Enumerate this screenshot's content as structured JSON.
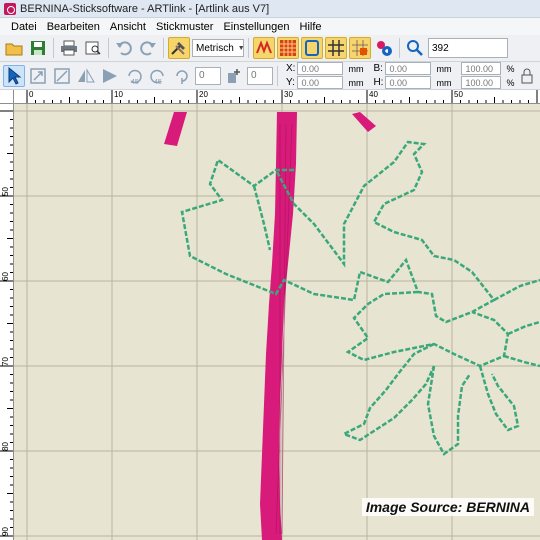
{
  "window": {
    "title": "BERNINA-Sticksoftware - ARTlink - [Artlink aus V7]"
  },
  "menu": {
    "items": [
      "Datei",
      "Bearbeiten",
      "Ansicht",
      "Stickmuster",
      "Einstellungen",
      "Hilfe"
    ]
  },
  "toolbar": {
    "units_value": "Metrisch",
    "zoom_value": "392"
  },
  "props": {
    "x_label": "X:",
    "y_label": "Y:",
    "b_label": "B:",
    "h_label": "H:",
    "x_value": "0.00",
    "y_value": "0.00",
    "b_value": "0.00",
    "h_value": "0.00",
    "unit_mm": "mm",
    "scale_b": "100.00",
    "scale_h": "100.00",
    "percent": "%",
    "angle_value": "0",
    "count_value": "0"
  },
  "rulers": {
    "top_labels": [
      "0",
      "10",
      "20",
      "30",
      "40",
      "50"
    ],
    "left_labels": [
      "50",
      "60",
      "70",
      "80",
      "90"
    ]
  },
  "colors": {
    "stem": "#d81b7a",
    "outline": "#3ba87a",
    "canvas_bg": "#e8e4d2",
    "grid": "#b8b59e"
  },
  "caption": {
    "text": "Image Source: BERNINA"
  }
}
